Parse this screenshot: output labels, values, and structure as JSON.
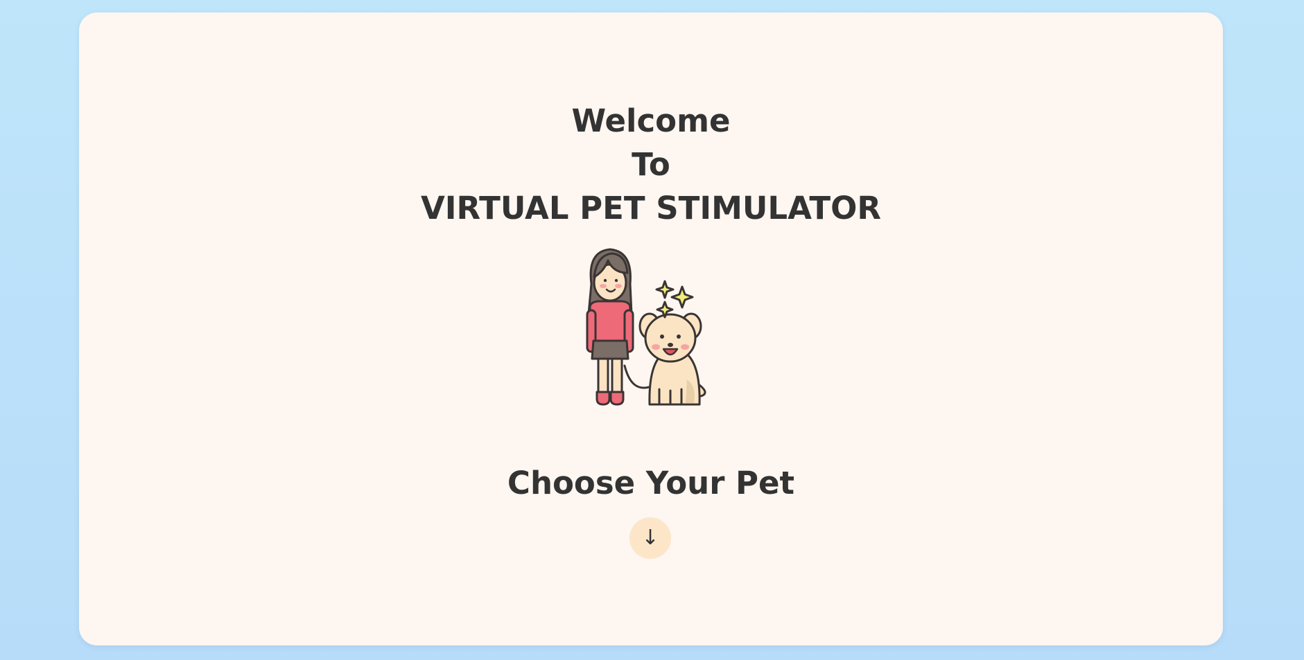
{
  "hero": {
    "line1": "Welcome",
    "line2": "To",
    "line3": "VIRTUAL PET STIMULATOR",
    "illustration_icon": "girl-with-dog-icon"
  },
  "cta": {
    "heading": "Choose Your Pet",
    "arrow_glyph": "↓",
    "arrow_icon": "arrow-down-icon"
  },
  "colors": {
    "page_background": "#bfe5fa",
    "card_background": "#fdf6f1",
    "text": "#333333",
    "arrow_button": "#fde6c8",
    "shirt": "#ee6a79",
    "dog": "#fbe4c3",
    "sparkle": "#f2ec7a"
  }
}
